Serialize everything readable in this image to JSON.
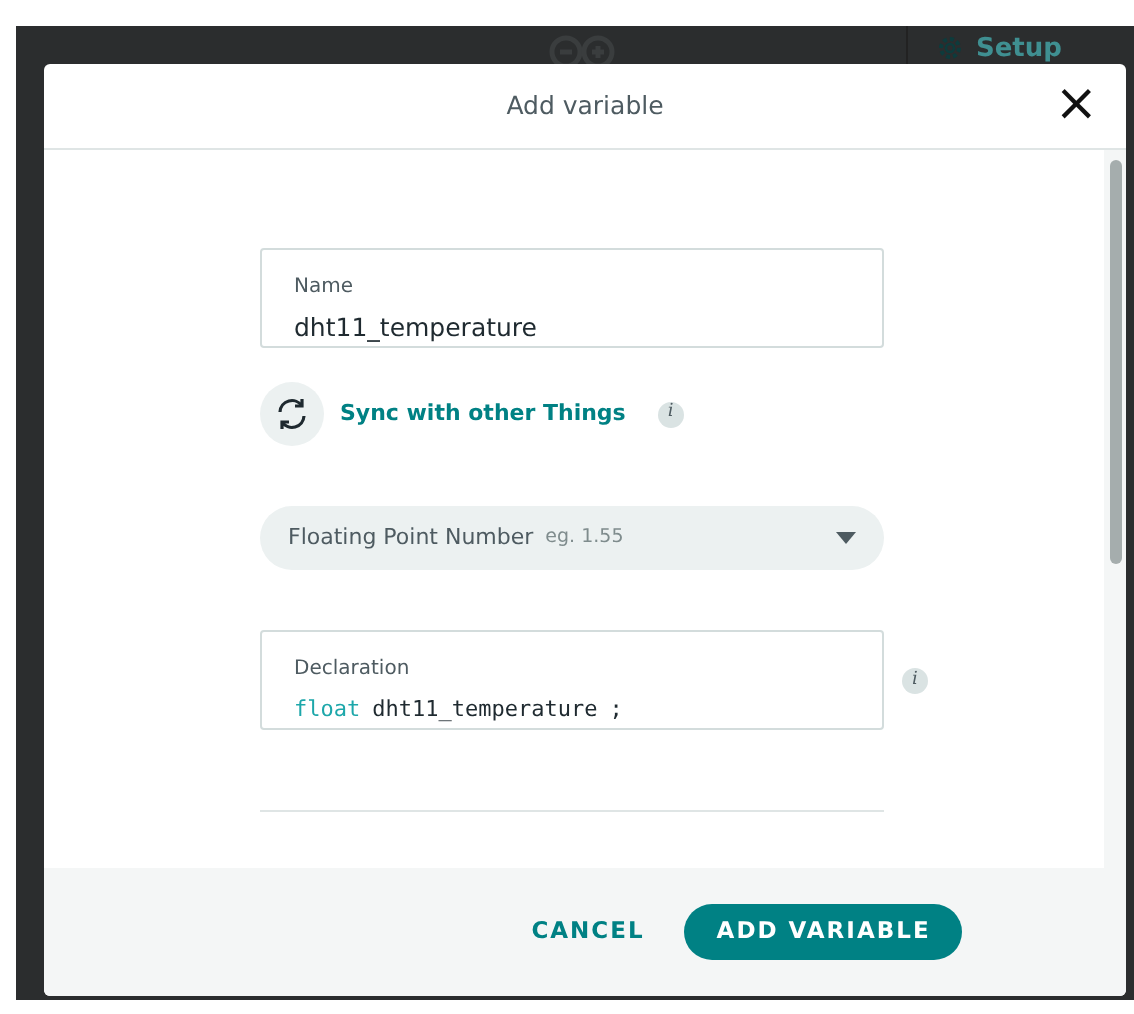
{
  "background": {
    "setup_label": "Setup"
  },
  "dialog": {
    "title": "Add variable",
    "close": "×"
  },
  "name_field": {
    "label": "Name",
    "value": "dht11_temperature"
  },
  "sync": {
    "label": "Sync with other Things",
    "info": "i"
  },
  "type_select": {
    "value": "Floating Point Number",
    "hint": "eg. 1.55"
  },
  "declaration": {
    "label": "Declaration",
    "info": "i",
    "tokens": [
      {
        "text": "float",
        "kind": "keyword"
      },
      {
        "text": "dht11_temperature",
        "kind": "name"
      },
      {
        "text": ";",
        "kind": "punct"
      }
    ]
  },
  "buttons": [
    {
      "label": "CANCEL",
      "kind": "secondary"
    },
    {
      "label": "ADD VARIABLE",
      "kind": "primary"
    }
  ]
}
